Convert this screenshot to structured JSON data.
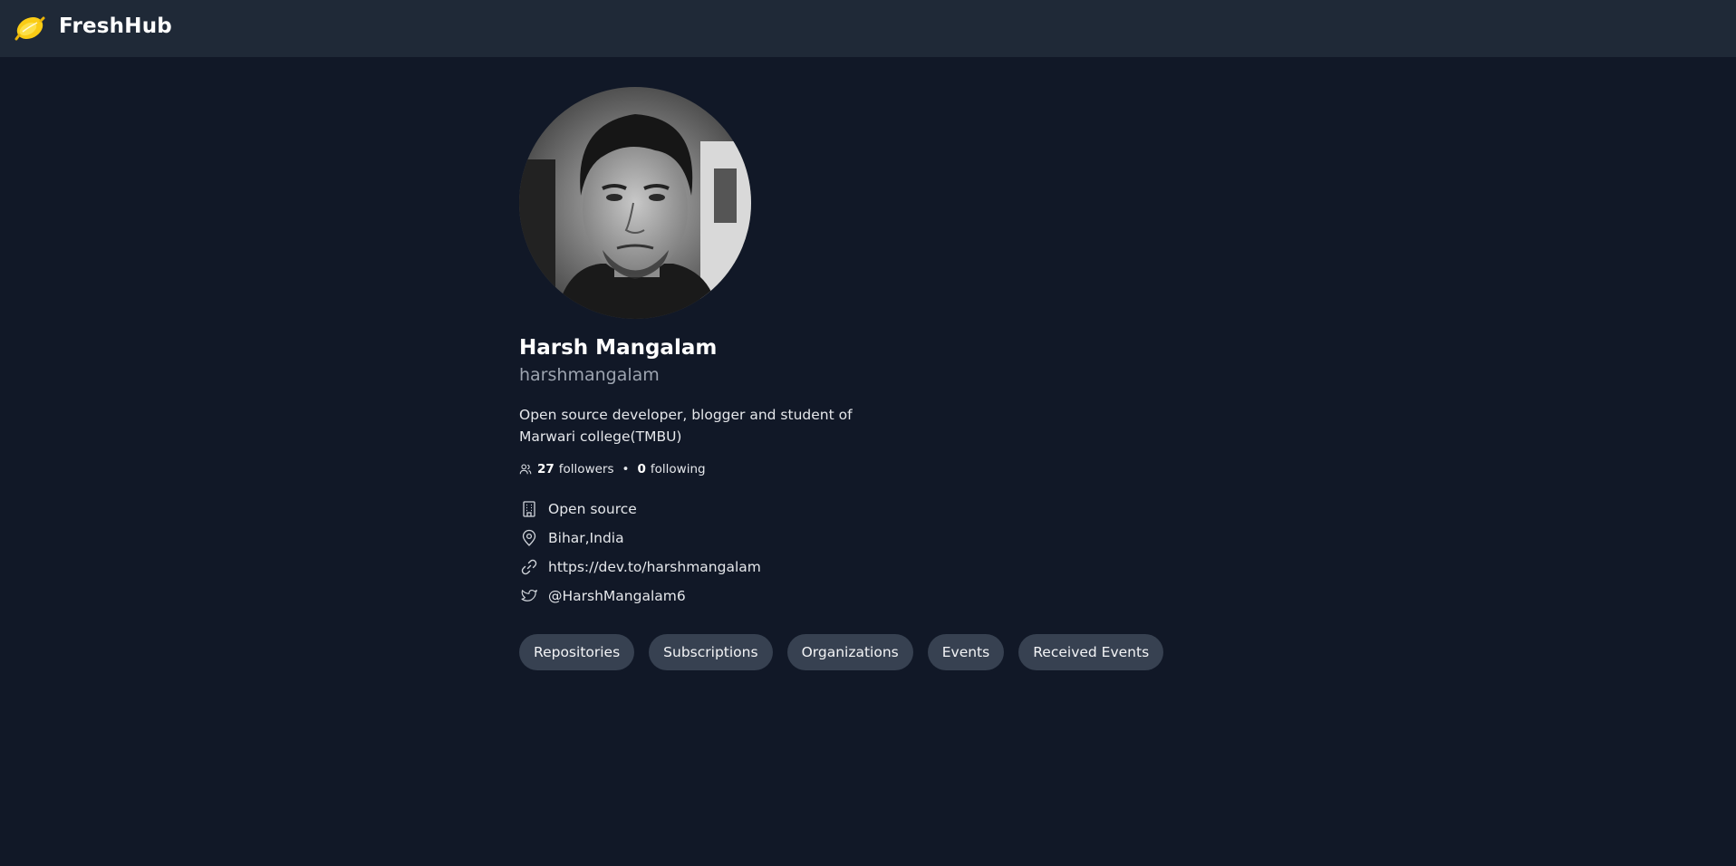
{
  "header": {
    "brand": "FreshHub",
    "logo_icon": "lemon-icon"
  },
  "profile": {
    "name": "Harsh Mangalam",
    "login": "harshmangalam",
    "bio": "Open source developer, blogger and student of Marwari college(TMBU)",
    "followers_count": "27",
    "followers_label": "followers",
    "separator": "•",
    "following_count": "0",
    "following_label": "following",
    "company": "Open source",
    "location": "Bihar,India",
    "website": "https://dev.to/harshmangalam",
    "twitter": "@HarshMangalam6"
  },
  "tabs": [
    {
      "label": "Repositories"
    },
    {
      "label": "Subscriptions"
    },
    {
      "label": "Organizations"
    },
    {
      "label": "Events"
    },
    {
      "label": "Received Events"
    }
  ],
  "colors": {
    "background": "#111827",
    "topbar": "#1f2937",
    "tab_bg": "#374151",
    "muted_text": "#9ca3af",
    "logo": "#facc15"
  }
}
